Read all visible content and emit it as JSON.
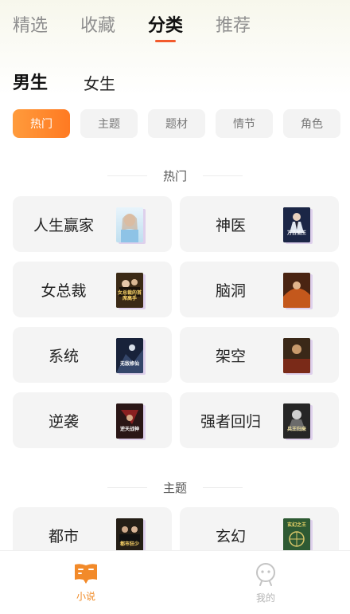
{
  "top_tabs": [
    {
      "label": "精选",
      "active": false
    },
    {
      "label": "收藏",
      "active": false
    },
    {
      "label": "分类",
      "active": true
    },
    {
      "label": "推荐",
      "active": false
    }
  ],
  "gender_tabs": [
    {
      "label": "男生",
      "active": true
    },
    {
      "label": "女生",
      "active": false
    }
  ],
  "filter_chips": [
    {
      "label": "热门",
      "active": true
    },
    {
      "label": "主题",
      "active": false
    },
    {
      "label": "题材",
      "active": false
    },
    {
      "label": "情节",
      "active": false
    },
    {
      "label": "角色",
      "active": false
    }
  ],
  "sections": [
    {
      "title": "热门",
      "categories": [
        {
          "label": "人生赢家",
          "cover_icon": "book-cover-girl",
          "cover_color": "#cfe7f5"
        },
        {
          "label": "神医",
          "cover_icon": "book-cover-suit",
          "cover_color": "#1e2a4a",
          "cover_text": "万古仙王"
        },
        {
          "label": "女总裁",
          "cover_icon": "book-cover-gold",
          "cover_color": "#3a2a1a",
          "cover_text": "女总裁的首席高手"
        },
        {
          "label": "脑洞",
          "cover_icon": "book-cover-fire",
          "cover_color": "#5a2c16"
        },
        {
          "label": "系统",
          "cover_icon": "book-cover-dark",
          "cover_color": "#1a2436",
          "cover_text": "无敌修仙"
        },
        {
          "label": "架空",
          "cover_icon": "book-cover-war",
          "cover_color": "#3a2818"
        },
        {
          "label": "逆袭",
          "cover_icon": "book-cover-red",
          "cover_color": "#2c1a1a",
          "cover_text": "逆天战神"
        },
        {
          "label": "强者回归",
          "cover_icon": "book-cover-warrior",
          "cover_color": "#2a2a2a",
          "cover_text": "兵王归来"
        }
      ]
    },
    {
      "title": "主题",
      "categories": [
        {
          "label": "都市",
          "cover_icon": "book-cover-city",
          "cover_color": "#2a241c",
          "cover_text": "都市狂少"
        },
        {
          "label": "玄幻",
          "cover_icon": "book-cover-green",
          "cover_color": "#2f5a34",
          "cover_text": "玄幻之王"
        }
      ]
    }
  ],
  "bottom_nav": [
    {
      "label": "小说",
      "icon": "book-icon",
      "active": true
    },
    {
      "label": "我的",
      "icon": "profile-icon",
      "active": false
    }
  ],
  "colors": {
    "accent": "#f25a2c",
    "chip_active": "#ff8a2c",
    "nav_active": "#f08a25",
    "card_bg": "#f4f4f4"
  }
}
